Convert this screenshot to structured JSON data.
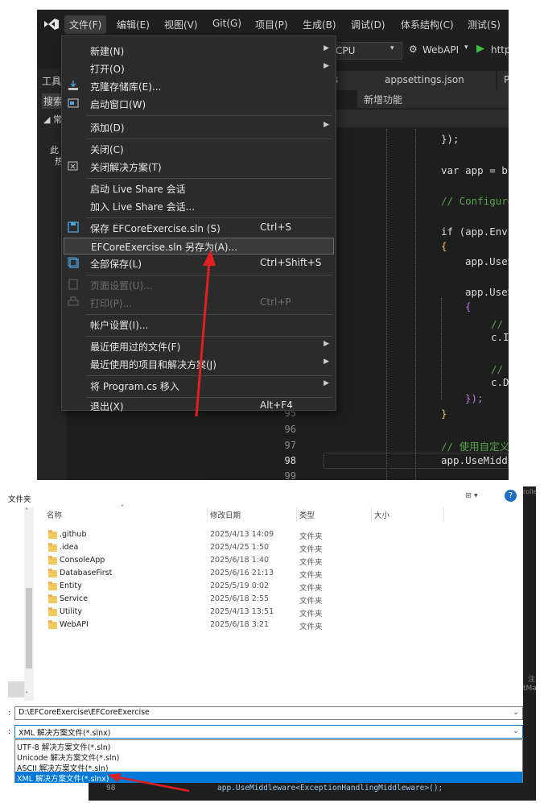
{
  "vs": {
    "menubar": [
      "文件(F)",
      "编辑(E)",
      "视图(V)",
      "Git(G)",
      "项目(P)",
      "生成(B)",
      "调试(D)",
      "体系结构(C)",
      "测试(S)"
    ],
    "toolbar": {
      "cpu": "CPU",
      "project": "WebAPI",
      "run": "http"
    },
    "tabs": {
      "tab_a": "s",
      "tab_b": "appsettings.json",
      "tab_c": "Pr",
      "tab_d": "新增功能"
    },
    "side_labels": {
      "tools": "工具",
      "search": "搜索",
      "tree": "◢ 常",
      "line1": "此",
      "line2": "热"
    },
    "file_menu": [
      {
        "label": "新建(N)",
        "shortcut": "",
        "submenu": true,
        "icon": "none",
        "disabled": false
      },
      {
        "label": "打开(O)",
        "shortcut": "",
        "submenu": true,
        "icon": "none",
        "disabled": false
      },
      {
        "label": "克隆存储库(E)...",
        "shortcut": "",
        "submenu": false,
        "icon": "clone-repo-icon",
        "disabled": false
      },
      {
        "label": "启动窗口(W)",
        "shortcut": "",
        "submenu": false,
        "icon": "start-window-icon",
        "disabled": false
      },
      {
        "label": "添加(D)",
        "shortcut": "",
        "submenu": true,
        "icon": "none",
        "disabled": false
      },
      {
        "label": "关闭(C)",
        "shortcut": "",
        "submenu": false,
        "icon": "none",
        "disabled": false
      },
      {
        "label": "关闭解决方案(T)",
        "shortcut": "",
        "submenu": false,
        "icon": "close-solution-icon",
        "disabled": false
      },
      {
        "label": "启动 Live Share 会话",
        "shortcut": "",
        "submenu": false,
        "icon": "none",
        "disabled": false
      },
      {
        "label": "加入 Live Share 会话...",
        "shortcut": "",
        "submenu": false,
        "icon": "none",
        "disabled": false
      },
      {
        "label": "保存 EFCoreExercise.sln (S)",
        "shortcut": "Ctrl+S",
        "submenu": false,
        "icon": "save-icon",
        "disabled": false
      },
      {
        "label": "EFCoreExercise.sln 另存为(A)...",
        "shortcut": "",
        "submenu": false,
        "icon": "none",
        "disabled": false,
        "highlighted": true
      },
      {
        "label": "全部保存(L)",
        "shortcut": "Ctrl+Shift+S",
        "submenu": false,
        "icon": "save-all-icon",
        "disabled": false
      },
      {
        "label": "页面设置(U)...",
        "shortcut": "",
        "submenu": false,
        "icon": "page-setup-icon",
        "disabled": true
      },
      {
        "label": "打印(P)...",
        "shortcut": "Ctrl+P",
        "submenu": false,
        "icon": "print-icon",
        "disabled": true
      },
      {
        "label": "帐户设置(I)...",
        "shortcut": "",
        "submenu": false,
        "icon": "none",
        "disabled": false
      },
      {
        "label": "最近使用过的文件(F)",
        "shortcut": "",
        "submenu": true,
        "icon": "none",
        "disabled": false
      },
      {
        "label": "最近使用的项目和解决方案(J)",
        "shortcut": "",
        "submenu": true,
        "icon": "none",
        "disabled": false
      },
      {
        "label": "将 Program.cs 移入",
        "shortcut": "",
        "submenu": true,
        "icon": "none",
        "disabled": false
      },
      {
        "label": "退出(X)",
        "shortcut": "Alt+F4",
        "submenu": false,
        "icon": "none",
        "disabled": false
      }
    ],
    "code_lines": [
      "});",
      "var app = builder",
      "// Configure the",
      "if (app.Environme",
      "{",
      "app.UseSwagge",
      "app.UseSwagge",
      "{",
      "// 将 Swa",
      "c.IndexSt",
      "// 设置界",
      "c.DocExpa",
      "});",
      "}",
      "// 使用自定义异常",
      "app.UseMiddleware"
    ],
    "line_numbers": [
      "95",
      "96",
      "97",
      "98",
      "99"
    ],
    "current_line": "98"
  },
  "dialog": {
    "title_fragment": "文件夹",
    "columns": {
      "name": "名称",
      "date": "修改日期",
      "type": "类型",
      "size": "大小"
    },
    "folders": [
      {
        "name": ".github",
        "date": "2025/4/13 14:09",
        "type": "文件夹"
      },
      {
        "name": ".idea",
        "date": "2025/4/25 1:50",
        "type": "文件夹"
      },
      {
        "name": "ConsoleApp",
        "date": "2025/6/18 1:40",
        "type": "文件夹"
      },
      {
        "name": "DatabaseFirst",
        "date": "2025/6/16 21:13",
        "type": "文件夹"
      },
      {
        "name": "Entity",
        "date": "2025/5/19 0:02",
        "type": "文件夹"
      },
      {
        "name": "Service",
        "date": "2025/6/18 2:55",
        "type": "文件夹"
      },
      {
        "name": "Utility",
        "date": "2025/4/13 13:51",
        "type": "文件夹"
      },
      {
        "name": "WebAPI",
        "date": "2025/6/18 3:21",
        "type": "文件夹"
      }
    ],
    "path_value": "D:\\EFCoreExercise\\EFCoreExercise",
    "save_type_value": "XML 解决方案文件(*.slnx)",
    "save_type_options": [
      "UTF-8 解决方案文件(*.sln)",
      "Unicode 解决方案文件(*.sln)",
      "ASCII 解决方案文件(*.sln)",
      "XML 解决方案文件(*.slnx)"
    ],
    "behind_code": "app.UseMiddleware<ExceptionHandlingMiddleware>();",
    "behind_line": "98",
    "edge_text": {
      "right_top": "rolle",
      "right_mid1": "注",
      "right_mid2": "tMa"
    },
    "colors": {
      "accent": "#0078d7",
      "annotation_arrow": "#e02020"
    }
  }
}
